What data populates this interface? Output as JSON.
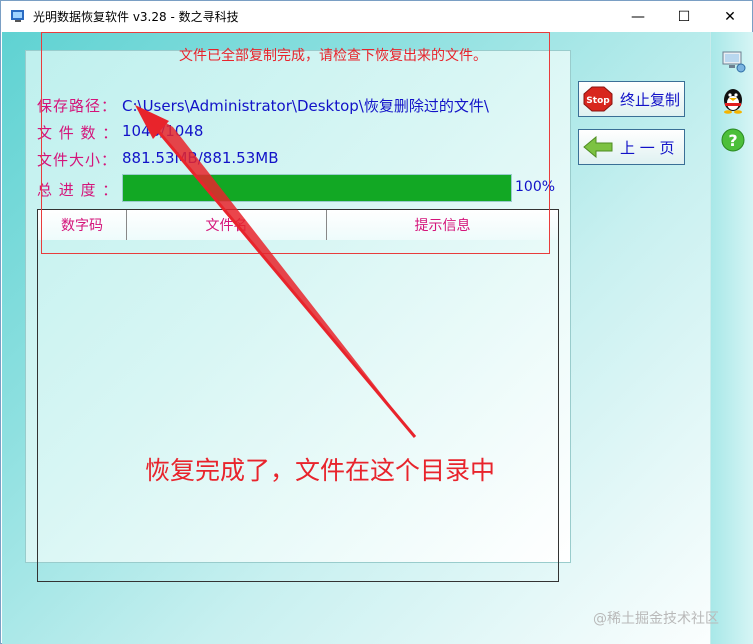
{
  "window": {
    "title": "光明数据恢复软件 v3.28 - 数之寻科技",
    "minimize_glyph": "—",
    "maximize_glyph": "☐",
    "close_glyph": "✕"
  },
  "status": {
    "path_label": "保存路径：",
    "path_value": "C:\\Users\\Administrator\\Desktop\\恢复删除过的文件\\",
    "count_label": "文 件 数 ：",
    "count_value": "1048/1048",
    "size_label": "文件大小：",
    "size_value": "881.53MB/881.53MB",
    "progress_label": "总 进 度 ：",
    "progress_percent": 100,
    "progress_text": "100%"
  },
  "table": {
    "columns": [
      "数字码",
      "文件名",
      "提示信息"
    ]
  },
  "buttons": {
    "stop_label": "终止复制",
    "stop_icon_text": "Stop",
    "back_label": "上 一 页"
  },
  "annotations": {
    "top_note": "文件已全部复制完成，请检查下恢复出来的文件。",
    "big_note": "恢复完成了，文件在这个目录中"
  },
  "watermark": "@稀土掘金技术社区",
  "colors": {
    "label": "#d4147a",
    "value": "#1212c8",
    "progress": "#12a824",
    "annotation": "#e8242c"
  }
}
